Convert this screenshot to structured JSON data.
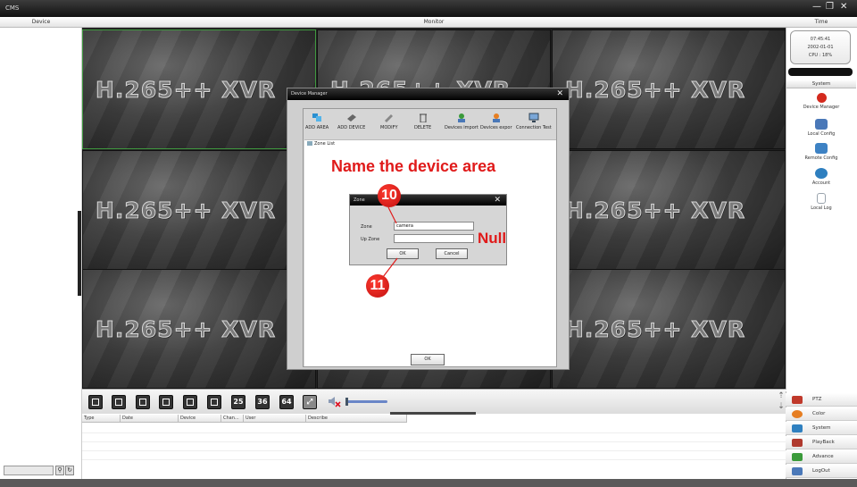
{
  "app": {
    "title": "CMS",
    "minimize": "—",
    "restore": "❐",
    "close": "✕"
  },
  "header": {
    "device": "Device",
    "monitor": "Monitor",
    "time": "Time"
  },
  "grid": {
    "watermark": "H.265++ XVR"
  },
  "clock": {
    "time": "07:45:41",
    "date": "2002-01-01",
    "cpu": "CPU : 18%"
  },
  "system_panel": {
    "title": "System",
    "items": [
      {
        "label": "Device Manager",
        "icon": "device-manager-icon",
        "color": "#d42a1e"
      },
      {
        "label": "Local Config",
        "icon": "local-config-icon",
        "color": "#4a78b8"
      },
      {
        "label": "Remote Config",
        "icon": "remote-config-icon",
        "color": "#3d82c4"
      },
      {
        "label": "Account",
        "icon": "account-icon",
        "color": "#2e7fbf"
      },
      {
        "label": "Local Log",
        "icon": "local-log-icon",
        "color": "#9aa4ad"
      }
    ]
  },
  "bottom_menu": [
    {
      "label": "PTZ",
      "icon": "ptz-icon",
      "color": "#c0392b"
    },
    {
      "label": "Color",
      "icon": "color-icon",
      "color": "#e67e22"
    },
    {
      "label": "System",
      "icon": "system-icon",
      "color": "#2f80c0"
    },
    {
      "label": "PlayBack",
      "icon": "playback-icon",
      "color": "#b03a2e"
    },
    {
      "label": "Advance",
      "icon": "advance-icon",
      "color": "#3a9a3a"
    },
    {
      "label": "LogOut",
      "icon": "logout-icon",
      "color": "#4a78b8"
    }
  ],
  "layout_bar": {
    "buttons": [
      "",
      "",
      "",
      "",
      "",
      "",
      "25",
      "36",
      "64"
    ]
  },
  "log_table": {
    "columns": [
      "Type",
      "Date",
      "Device",
      "Chan...",
      "User",
      "Describe"
    ]
  },
  "device_manager": {
    "title": "Device Manager",
    "toolbar": [
      {
        "label": "ADD AREA",
        "icon": "add-area-icon"
      },
      {
        "label": "ADD DEVICE",
        "icon": "add-device-icon"
      },
      {
        "label": "MODIFY",
        "icon": "modify-icon"
      },
      {
        "label": "DELETE",
        "icon": "delete-icon"
      },
      {
        "label": "Devices import",
        "icon": "devices-import-icon"
      },
      {
        "label": "Devices expor",
        "icon": "devices-export-icon"
      },
      {
        "label": "Connection Test",
        "icon": "connection-test-icon"
      }
    ],
    "zone_list_label": "Zone List",
    "ok_label": "OK"
  },
  "annotations": {
    "headline": "Name the device area",
    "null_note": "Null",
    "step_a": "10",
    "step_b": "11",
    "color": "#e01a1a"
  },
  "zone_dialog": {
    "title": "Zone",
    "zone_label": "Zone",
    "zone_value": "camera",
    "up_zone_label": "Up Zone",
    "up_zone_value": "",
    "ok_label": "OK",
    "cancel_label": "Cancel"
  }
}
